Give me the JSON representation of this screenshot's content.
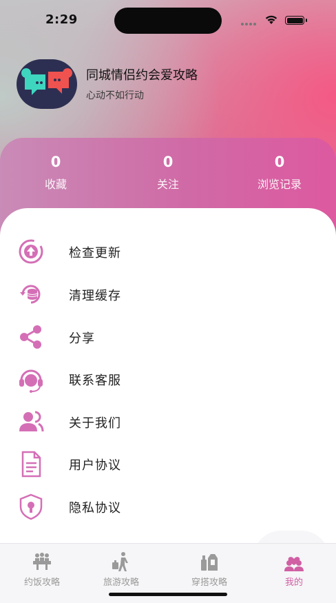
{
  "status_bar": {
    "time": "2:29"
  },
  "profile": {
    "app_name": "同城情侣约会爱攻略",
    "slogan": "心动不如行动"
  },
  "stats": [
    {
      "value": "0",
      "label": "收藏"
    },
    {
      "value": "0",
      "label": "关注"
    },
    {
      "value": "0",
      "label": "浏览记录"
    }
  ],
  "menu": {
    "items": [
      {
        "label": "检查更新",
        "icon": "update-icon"
      },
      {
        "label": "清理缓存",
        "icon": "clear-cache-icon"
      },
      {
        "label": "分享",
        "icon": "share-icon"
      },
      {
        "label": "联系客服",
        "icon": "headset-icon"
      },
      {
        "label": "关于我们",
        "icon": "about-us-icon"
      },
      {
        "label": "用户协议",
        "icon": "document-icon"
      },
      {
        "label": "隐私协议",
        "icon": "privacy-shield-icon"
      }
    ]
  },
  "tabbar": {
    "tabs": [
      {
        "label": "约饭攻略",
        "icon": "dining-icon",
        "active": false
      },
      {
        "label": "旅游攻略",
        "icon": "travel-icon",
        "active": false
      },
      {
        "label": "穿搭攻略",
        "icon": "outfit-icon",
        "active": false
      },
      {
        "label": "我的",
        "icon": "profile-icon",
        "active": true
      }
    ]
  },
  "colors": {
    "accent": "#d05fa4",
    "icon_pink": "#d46fb6",
    "inactive": "#9a9a9a"
  }
}
